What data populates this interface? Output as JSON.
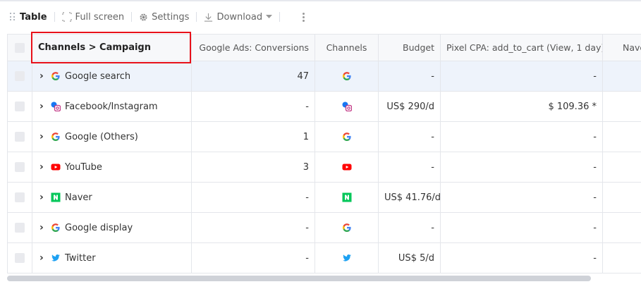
{
  "toolbar": {
    "title": "Table",
    "fullscreen_label": "Full screen",
    "settings_label": "Settings",
    "download_label": "Download"
  },
  "columns": {
    "name": "Channels > Campaign",
    "conversions": "Google Ads: Conversions",
    "channels": "Channels",
    "budget": "Budget",
    "pixel_cpa": "Pixel CPA: add_to_cart (View, 1 day)",
    "naver": "Nave"
  },
  "rows": [
    {
      "name": "Google search",
      "icon": "google-icon",
      "conversions": "47",
      "budget": "-",
      "pixel_cpa": "-",
      "naver": ""
    },
    {
      "name": "Facebook/Instagram",
      "icon": "facebook-instagram-icon",
      "conversions": "-",
      "budget": "US$ 290/d",
      "pixel_cpa": "$ 109.36 *",
      "naver": ""
    },
    {
      "name": "Google (Others)",
      "icon": "google-icon",
      "conversions": "1",
      "budget": "-",
      "pixel_cpa": "-",
      "naver": ""
    },
    {
      "name": "YouTube",
      "icon": "youtube-icon",
      "conversions": "3",
      "budget": "-",
      "pixel_cpa": "-",
      "naver": ""
    },
    {
      "name": "Naver",
      "icon": "naver-icon",
      "conversions": "-",
      "budget": "US$ 41.76/d",
      "pixel_cpa": "-",
      "naver": ""
    },
    {
      "name": "Google display",
      "icon": "google-icon",
      "conversions": "-",
      "budget": "-",
      "pixel_cpa": "-",
      "naver": ""
    },
    {
      "name": "Twitter",
      "icon": "twitter-icon",
      "conversions": "-",
      "budget": "US$ 5/d",
      "pixel_cpa": "-",
      "naver": ""
    }
  ],
  "colors": {
    "highlight_row": "#eef3fb",
    "annotation_box": "#e8111a",
    "youtube": "#ff0000",
    "naver": "#03c75a",
    "twitter": "#1da1f2"
  }
}
